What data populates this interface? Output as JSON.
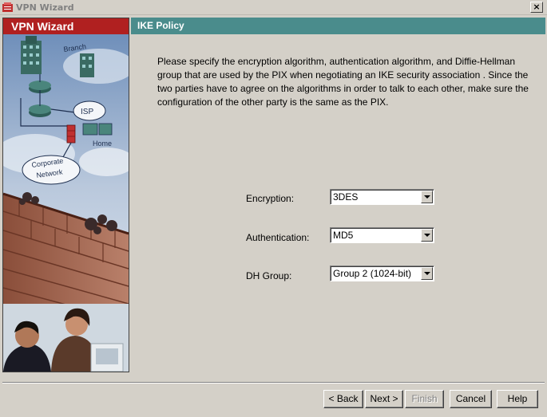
{
  "window": {
    "title": "VPN Wizard",
    "close_label": "×"
  },
  "sidebar": {
    "header": "VPN Wizard",
    "illustration": {
      "branch": "Branch",
      "isp": "ISP",
      "home": "Home",
      "corporate": "Corporate",
      "network": "Network"
    }
  },
  "page": {
    "title": "IKE Policy",
    "description": "Please specify the encryption algorithm, authentication algorithm, and Diffie-Hellman group that are used by the PIX when negotiating an IKE security association . Since the two parties have to agree on the algorithms in order to talk to each other, make sure the configuration of the other party is the same as the PIX."
  },
  "form": {
    "encryption": {
      "label": "Encryption:",
      "value": "3DES"
    },
    "authentication": {
      "label": "Authentication:",
      "value": "MD5"
    },
    "dh_group": {
      "label": "DH Group:",
      "value": "Group 2 (1024-bit)"
    }
  },
  "buttons": {
    "back": "< Back",
    "next": "Next >",
    "finish": "Finish",
    "cancel": "Cancel",
    "help": "Help"
  },
  "colors": {
    "left_header": "#b02020",
    "right_header": "#4a8c8c",
    "dialog_bg": "#d4d0c8"
  }
}
